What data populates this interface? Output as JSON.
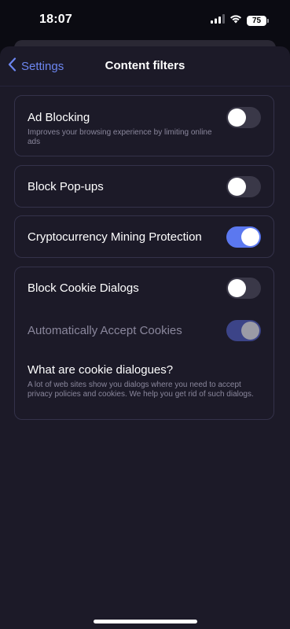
{
  "status_bar": {
    "time": "18:07",
    "battery": "75",
    "icons": [
      "signal-icon",
      "wifi-icon",
      "battery-icon"
    ]
  },
  "nav": {
    "back_label": "Settings",
    "title": "Content filters"
  },
  "filters": {
    "ad_blocking": {
      "title": "Ad Blocking",
      "description": "Improves your browsing experience by limiting online ads",
      "enabled": false
    },
    "block_popups": {
      "title": "Block Pop-ups",
      "enabled": false
    },
    "crypto_mining": {
      "title": "Cryptocurrency Mining Protection",
      "enabled": true
    },
    "cookie_dialogs": {
      "title": "Block Cookie Dialogs",
      "enabled": false
    },
    "accept_cookies": {
      "title": "Automatically Accept Cookies",
      "enabled": true,
      "disabled": true
    },
    "cookie_info": {
      "title": "What are cookie dialogues?",
      "text": "A lot of web sites show you dialogs where you need to accept privacy policies and cookies. We help you get rid of such dialogs."
    }
  },
  "colors": {
    "accent": "#6c86f0",
    "toggle_on": "#5b78f0",
    "background": "#1c1a28"
  }
}
